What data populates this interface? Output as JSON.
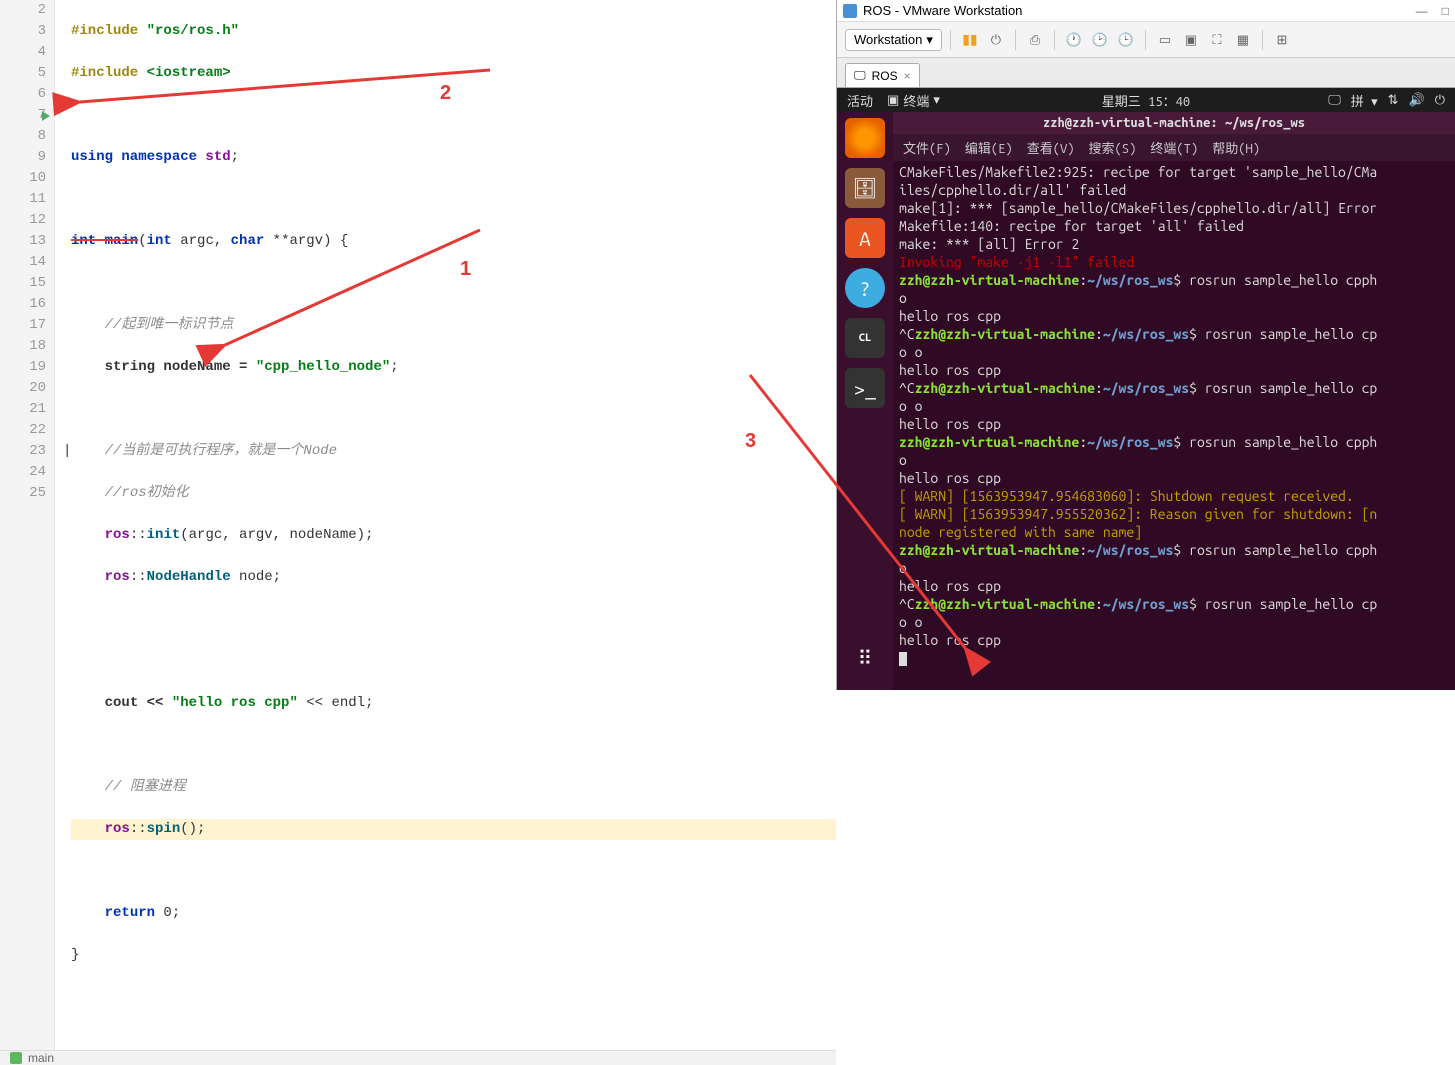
{
  "code": {
    "lines": [
      "2",
      "3",
      "4",
      "5",
      "6",
      "7",
      "8",
      "9",
      "10",
      "11",
      "12",
      "13",
      "14",
      "15",
      "16",
      "17",
      "18",
      "19",
      "20",
      "21",
      "22",
      "23",
      "24",
      "25"
    ],
    "include1_a": "#include ",
    "include1_b": "\"ros/ros.h\"",
    "include2_a": "#include ",
    "include2_b": "<iostream>",
    "using_a": "using namespace ",
    "using_b": "std",
    "using_c": ";",
    "main_a": "int main",
    "main_b": "(",
    "main_c": "int",
    "main_d": " argc, ",
    "main_e": "char",
    "main_f": " **argv) {",
    "cmt1": "//起到唯一标识节点",
    "nodename_a": "string nodeName = ",
    "nodename_b": "\"cpp_hello_node\"",
    "nodename_c": ";",
    "bp_mark": "|",
    "cmt2": "//当前是可执行程序，就是一个Node",
    "cmt3": "//ros初始化",
    "init_a": "ros",
    "init_b": "::",
    "init_c": "init",
    "init_d": "(argc, argv, nodeName);",
    "nh_a": "ros",
    "nh_b": "::",
    "nh_c": "NodeHandle",
    "nh_d": " node;",
    "cout_a": "cout << ",
    "cout_b": "\"hello ros cpp\"",
    "cout_c": " << endl;",
    "cmt4": "// 阻塞进程",
    "spin_a": "ros",
    "spin_b": "::",
    "spin_c": "spin",
    "spin_d": "();",
    "ret_a": "return ",
    "ret_b": "0",
    "ret_c": ";",
    "close": "}"
  },
  "annotations": {
    "a1": "1",
    "a2": "2",
    "a3": "3"
  },
  "statusbar": {
    "main": "main"
  },
  "vmware": {
    "title": "ROS - VMware Workstation",
    "menu": "Workstation",
    "tab": "ROS"
  },
  "ubuntu": {
    "activities": "活动",
    "termapp": "终端",
    "date": "星期三 15：40",
    "ime": "拼",
    "title": "zzh@zzh-virtual-machine: ~/ws/ros_ws",
    "menu": {
      "file": "文件(F)",
      "edit": "编辑(E)",
      "view": "查看(V)",
      "search": "搜索(S)",
      "term": "终端(T)",
      "help": "帮助(H)"
    }
  },
  "terminal": {
    "l1": "CMakeFiles/Makefile2:925: recipe for target 'sample_hello/CMa",
    "l2": "iles/cpphello.dir/all' failed",
    "l3": "make[1]: *** [sample_hello/CMakeFiles/cpphello.dir/all] Error",
    "l4": "Makefile:140: recipe for target 'all' failed",
    "l5": "make: *** [all] Error 2",
    "l6a": "Invoking ",
    "l6b": "\"make -j1 -l1\"",
    "l6c": " failed",
    "prompt_user": "zzh@zzh-virtual-machine",
    "prompt_sep": ":",
    "prompt_path": "~/ws/ros_ws",
    "prompt_end": "$ ",
    "cmd1": "rosrun sample_hello cpph",
    "out_o": "o",
    "out_hello": "hello ros cpp",
    "cmd2": "rosrun sample_hello cp",
    "out_oo": "o o",
    "warn1": "[ WARN] [1563953947.954683060]: Shutdown request received.",
    "warn2": "[ WARN] [1563953947.955520362]: Reason given for shutdown: [n",
    "warn3": "node registered with same name]",
    "ctrlc": "^C"
  }
}
